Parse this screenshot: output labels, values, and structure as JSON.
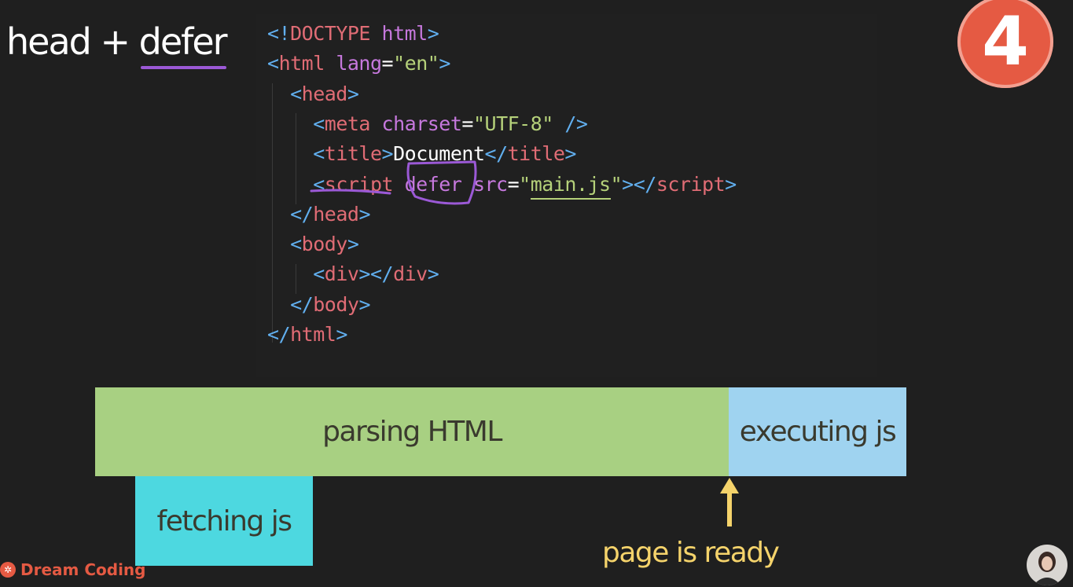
{
  "slide": {
    "title_prefix": "head + ",
    "title_emphasis": "defer",
    "step_badge": "4"
  },
  "code": [
    [
      {
        "t": "<!",
        "c": "punct"
      },
      {
        "t": "DOCTYPE",
        "c": "tag"
      },
      {
        "t": " html",
        "c": "attr"
      },
      {
        "t": ">",
        "c": "punct"
      }
    ],
    [
      {
        "t": "<",
        "c": "punct"
      },
      {
        "t": "html",
        "c": "tag"
      },
      {
        "t": " lang",
        "c": "attr"
      },
      {
        "t": "=",
        "c": "txt"
      },
      {
        "t": "\"en\"",
        "c": "str"
      },
      {
        "t": ">",
        "c": "punct"
      }
    ],
    [
      {
        "t": "  <",
        "c": "punct"
      },
      {
        "t": "head",
        "c": "tag"
      },
      {
        "t": ">",
        "c": "punct"
      }
    ],
    [
      {
        "t": "    <",
        "c": "punct"
      },
      {
        "t": "meta",
        "c": "tag"
      },
      {
        "t": " charset",
        "c": "attr"
      },
      {
        "t": "=",
        "c": "txt"
      },
      {
        "t": "\"UTF-8\"",
        "c": "str"
      },
      {
        "t": " />",
        "c": "punct"
      }
    ],
    [
      {
        "t": "    <",
        "c": "punct"
      },
      {
        "t": "title",
        "c": "tag"
      },
      {
        "t": ">",
        "c": "punct"
      },
      {
        "t": "Document",
        "c": "txt"
      },
      {
        "t": "</",
        "c": "punct"
      },
      {
        "t": "title",
        "c": "tag"
      },
      {
        "t": ">",
        "c": "punct"
      }
    ],
    [
      {
        "t": "    <",
        "c": "punct"
      },
      {
        "t": "script",
        "c": "tag"
      },
      {
        "t": " defer",
        "c": "attr"
      },
      {
        "t": " src",
        "c": "attr"
      },
      {
        "t": "=",
        "c": "txt"
      },
      {
        "t": "\"",
        "c": "str"
      },
      {
        "t": "main.js",
        "c": "str",
        "u": true
      },
      {
        "t": "\"",
        "c": "str"
      },
      {
        "t": "></",
        "c": "punct"
      },
      {
        "t": "script",
        "c": "tag"
      },
      {
        "t": ">",
        "c": "punct"
      }
    ],
    [
      {
        "t": "  </",
        "c": "punct"
      },
      {
        "t": "head",
        "c": "tag"
      },
      {
        "t": ">",
        "c": "punct"
      }
    ],
    [
      {
        "t": "  <",
        "c": "punct"
      },
      {
        "t": "body",
        "c": "tag"
      },
      {
        "t": ">",
        "c": "punct"
      }
    ],
    [
      {
        "t": "    <",
        "c": "punct"
      },
      {
        "t": "div",
        "c": "tag"
      },
      {
        "t": "></",
        "c": "punct"
      },
      {
        "t": "div",
        "c": "tag"
      },
      {
        "t": ">",
        "c": "punct"
      }
    ],
    [
      {
        "t": "  </",
        "c": "punct"
      },
      {
        "t": "body",
        "c": "tag"
      },
      {
        "t": ">",
        "c": "punct"
      }
    ],
    [
      {
        "t": "</",
        "c": "punct"
      },
      {
        "t": "html",
        "c": "tag"
      },
      {
        "t": ">",
        "c": "punct"
      }
    ]
  ],
  "timeline": {
    "parsing_label": "parsing HTML",
    "executing_label": "executing js",
    "fetching_label": "fetching js",
    "ready_label": "page is ready"
  },
  "brand": {
    "name": "Dream Coding"
  },
  "colors": {
    "background": "#1f1f1f",
    "accent_purple": "#9b59d6",
    "badge": "#e55a43",
    "parsing": "#a8d082",
    "executing": "#9fd3f0",
    "fetching": "#4dd8e0",
    "ready": "#f5d36b"
  }
}
